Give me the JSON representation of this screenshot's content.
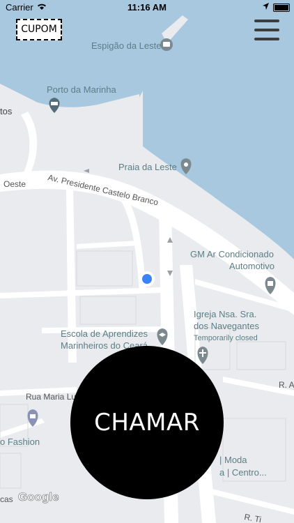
{
  "status_bar": {
    "carrier": "Carrier",
    "time": "11:16 AM"
  },
  "toolbar": {
    "coupon_label": "CUPOM"
  },
  "map": {
    "places": {
      "espigao": "Espigão da Leste",
      "porto": "Porto da Marinha",
      "praia": "Praia da Leste",
      "gm_line1": "GM Ar Condicionado",
      "gm_line2": "Automotivo",
      "escola_line1": "Escola de Aprendizes",
      "escola_line2": "Marinheiros do Ceará",
      "igreja_line1": "Igreja Nsa. Sra.",
      "igreja_line2": "dos Navegantes",
      "igreja_status": "Temporarily closed",
      "fashion": "o Fashion",
      "moda_line1": "| Moda",
      "moda_line2": "a | Centro...",
      "partial_tos": "tos"
    },
    "roads": {
      "oeste": "Oeste",
      "castelo_branco": "Av. Presidente Castelo Branco",
      "maria_luiza": "Rua Maria Luiza",
      "r_a": "R. A",
      "r_ti": "R. Ti",
      "cas": "cas"
    },
    "attribution": "Google",
    "colors": {
      "water": "#a8c8e0",
      "land": "#e9ebee",
      "road": "#ffffff",
      "user_dot": "#3b82f6"
    }
  },
  "call_button": {
    "label": "CHAMAR"
  }
}
